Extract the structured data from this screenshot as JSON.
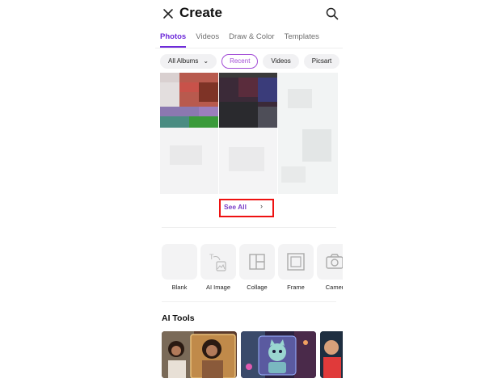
{
  "header": {
    "title": "Create"
  },
  "tabs": [
    {
      "label": "Photos",
      "active": true
    },
    {
      "label": "Videos",
      "active": false
    },
    {
      "label": "Draw & Color",
      "active": false
    },
    {
      "label": "Templates",
      "active": false
    }
  ],
  "filters": {
    "album": "All Albums",
    "chips": [
      {
        "label": "Recent",
        "active": true
      },
      {
        "label": "Videos",
        "active": false
      },
      {
        "label": "Picsart",
        "active": false
      }
    ]
  },
  "see_all": {
    "label": "See All"
  },
  "create_options": [
    {
      "label": "Blank",
      "icon": "blank-canvas-icon"
    },
    {
      "label": "AI Image",
      "icon": "ai-image-icon"
    },
    {
      "label": "Collage",
      "icon": "collage-icon"
    },
    {
      "label": "Frame",
      "icon": "frame-icon"
    },
    {
      "label": "Camer",
      "icon": "camera-icon"
    }
  ],
  "ai_tools": {
    "title": "AI Tools"
  },
  "colors": {
    "accent": "#6e2bd9",
    "chip_active": "#a24cd6",
    "highlight": "#e11111"
  }
}
